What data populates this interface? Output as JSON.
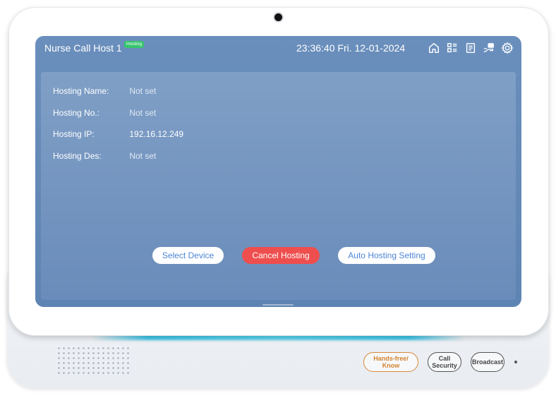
{
  "status_bar": {
    "device_title": "Nurse Call Host 1",
    "badge": "Hosting",
    "clock": "23:36:40 Fri. 12-01-2024",
    "icons": [
      "home-icon",
      "list-icon",
      "notes-icon",
      "hosting-icon",
      "settings-icon"
    ]
  },
  "hosting_info": {
    "rows": [
      {
        "label": "Hosting Name:",
        "value": "Not set"
      },
      {
        "label": "Hosting No.:",
        "value": "Not set"
      },
      {
        "label": "Hosting IP:",
        "value": "192.16.12.249"
      },
      {
        "label": "Hosting Des:",
        "value": "Not set"
      }
    ]
  },
  "actions": {
    "select_device": "Select Device",
    "cancel_hosting": "Cancel Hosting",
    "auto_hosting_setting": "Auto Hosting Setting"
  },
  "hardware_buttons": {
    "hands_free": "Hands-free/\nKnow",
    "call_security": "Call\nSecurity",
    "broadcast": "Broadcast"
  },
  "colors": {
    "screen_bg": "#6a8fbc",
    "badge_green": "#37c46e",
    "cancel_red": "#ef4e4e",
    "link_blue": "#4d86d6",
    "hands_free_orange": "#d98a3c"
  }
}
